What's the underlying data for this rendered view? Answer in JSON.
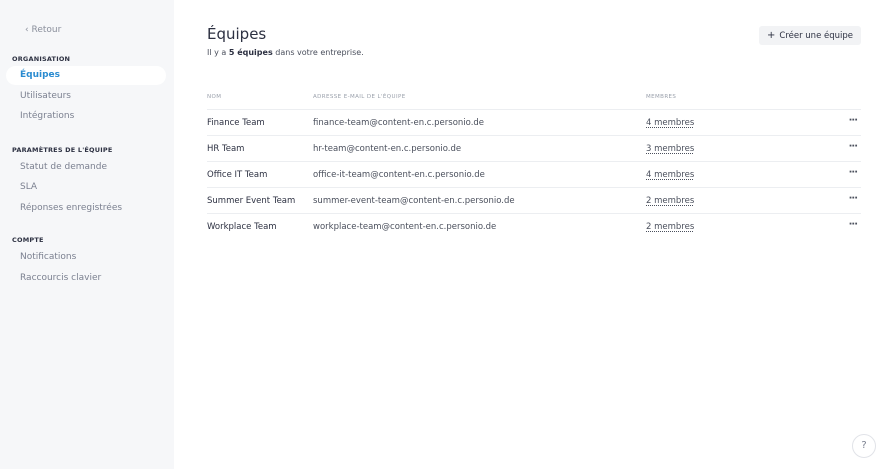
{
  "sidebar": {
    "back_label": "Retour",
    "sections": [
      {
        "title": "ORGANISATION",
        "items": [
          "Équipes",
          "Utilisateurs",
          "Intégrations"
        ]
      },
      {
        "title": "PARAMÈTRES DE L'ÉQUIPE",
        "items": [
          "Statut de demande",
          "SLA",
          "Réponses enregistrées"
        ]
      },
      {
        "title": "COMPTE",
        "items": [
          "Notifications",
          "Raccourcis clavier"
        ]
      }
    ]
  },
  "main": {
    "title": "Équipes",
    "subtitle_prefix": "Il y a ",
    "subtitle_count": "5 équipes",
    "subtitle_suffix": " dans votre entreprise.",
    "create_button": "Créer une équipe",
    "columns": [
      "NOM",
      "ADRESSE E-MAIL DE L'ÉQUIPE",
      "MEMBRES"
    ],
    "rows": [
      {
        "name": "Finance Team",
        "email": "finance-team@content-en.c.personio.de",
        "members": "4 membres"
      },
      {
        "name": "HR Team",
        "email": "hr-team@content-en.c.personio.de",
        "members": "3 membres"
      },
      {
        "name": "Office IT Team",
        "email": "office-it-team@content-en.c.personio.de",
        "members": "4 membres"
      },
      {
        "name": "Summer Event Team",
        "email": "summer-event-team@content-en.c.personio.de",
        "members": "2 membres"
      },
      {
        "name": "Workplace Team",
        "email": "workplace-team@content-en.c.personio.de",
        "members": "2 membres"
      }
    ],
    "row_menu": "···"
  },
  "help_label": "?",
  "colors": {
    "accent": "#2a8bd0",
    "sidebar_bg": "#f6f7f9"
  }
}
